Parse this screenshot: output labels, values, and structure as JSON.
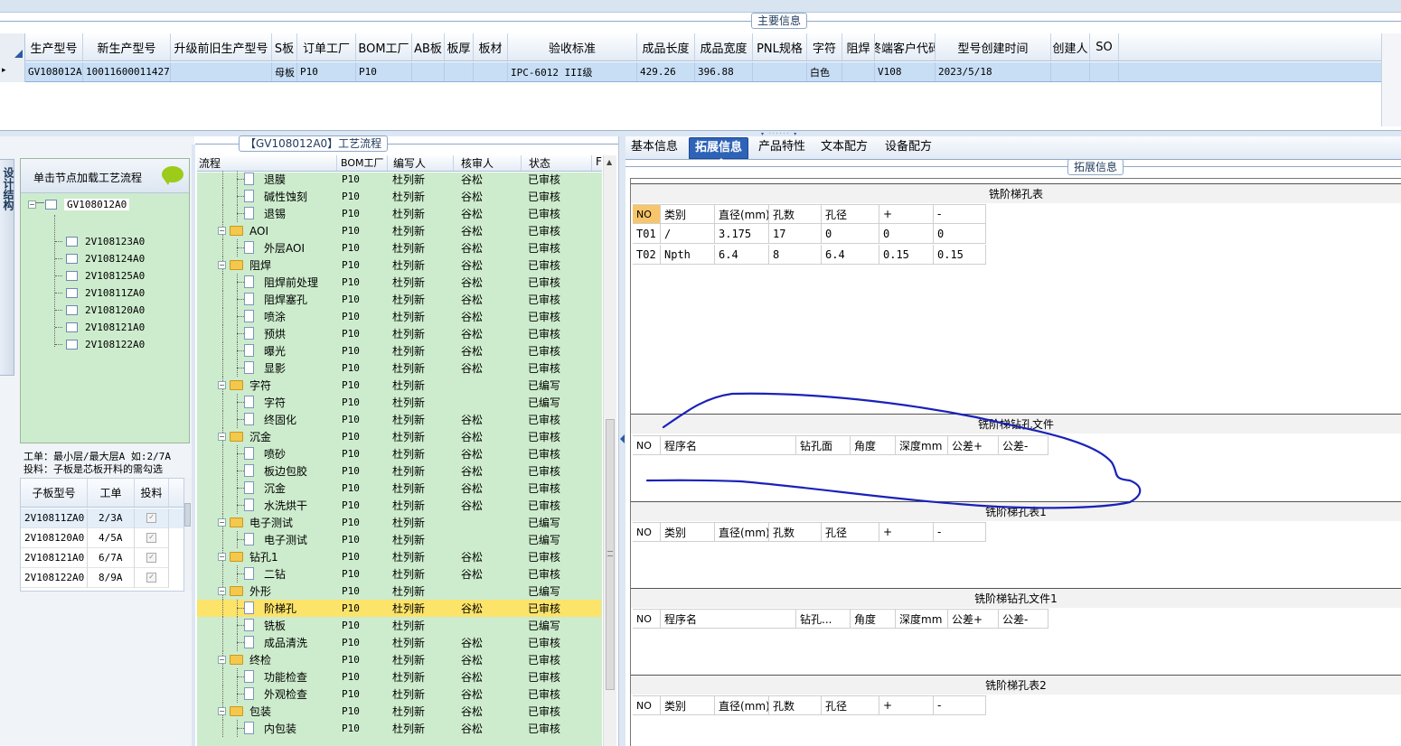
{
  "main_info": {
    "title": "主要信息",
    "columns": [
      "生产型号",
      "新生产型号",
      "升级前旧生产型号",
      "S板",
      "订单工厂",
      "BOM工厂",
      "AB板",
      "板厚",
      "板材",
      "验收标准",
      "成品长度",
      "成品宽度",
      "PNL规格",
      "字符",
      "阻焊",
      "终端客户代码",
      "型号创建时间",
      "创建人",
      "SO"
    ],
    "row": [
      "GV108012A0",
      "10011600011427",
      "",
      "母板",
      "P10",
      "P10",
      "",
      "",
      "",
      "IPC-6012 III级",
      "429.26",
      "396.88",
      "",
      "白色",
      "",
      "V108",
      "2023/5/18",
      "",
      ""
    ]
  },
  "left_panel": {
    "vertical_tab": "设计结构",
    "hint": "单击节点加载工艺流程",
    "tree_root": "GV108012A0",
    "tree_children": [
      "2V108123A0",
      "2V108124A0",
      "2V108125A0",
      "2V10811ZA0",
      "2V108120A0",
      "2V108121A0",
      "2V108122A0"
    ],
    "note_line1": "工单：最小层/最大层A 如:2/7A",
    "note_line2": "投料：子板是芯板开料的需勾选",
    "sub_headers": [
      "子板型号",
      "工单",
      "投料"
    ],
    "sub_rows": [
      {
        "model": "2V10811ZA0",
        "order": "2/3A"
      },
      {
        "model": "2V108120A0",
        "order": "4/5A"
      },
      {
        "model": "2V108121A0",
        "order": "6/7A"
      },
      {
        "model": "2V108122A0",
        "order": "8/9A"
      }
    ]
  },
  "process": {
    "title": "【GV108012A0】工艺流程",
    "headers": [
      "流程",
      "BOM工厂",
      "编写人",
      "核审人",
      "状态",
      "F"
    ],
    "rows": [
      {
        "name": "退膜",
        "type": "leaf",
        "bom": "P10",
        "writer": "杜列新",
        "reviewer": "谷松",
        "status": "已审核"
      },
      {
        "name": "碱性蚀刻",
        "type": "leaf",
        "bom": "P10",
        "writer": "杜列新",
        "reviewer": "谷松",
        "status": "已审核"
      },
      {
        "name": "退锡",
        "type": "leaf",
        "bom": "P10",
        "writer": "杜列新",
        "reviewer": "谷松",
        "status": "已审核"
      },
      {
        "name": "AOI",
        "type": "folder",
        "bom": "P10",
        "writer": "杜列新",
        "reviewer": "谷松",
        "status": "已审核"
      },
      {
        "name": "外层AOI",
        "type": "leaf",
        "bom": "P10",
        "writer": "杜列新",
        "reviewer": "谷松",
        "status": "已审核"
      },
      {
        "name": "阻焊",
        "type": "folder",
        "bom": "P10",
        "writer": "杜列新",
        "reviewer": "谷松",
        "status": "已审核"
      },
      {
        "name": "阻焊前处理",
        "type": "leaf",
        "bom": "P10",
        "writer": "杜列新",
        "reviewer": "谷松",
        "status": "已审核"
      },
      {
        "name": "阻焊塞孔",
        "type": "leaf",
        "bom": "P10",
        "writer": "杜列新",
        "reviewer": "谷松",
        "status": "已审核"
      },
      {
        "name": "喷涂",
        "type": "leaf",
        "bom": "P10",
        "writer": "杜列新",
        "reviewer": "谷松",
        "status": "已审核"
      },
      {
        "name": "预烘",
        "type": "leaf",
        "bom": "P10",
        "writer": "杜列新",
        "reviewer": "谷松",
        "status": "已审核"
      },
      {
        "name": "曝光",
        "type": "leaf",
        "bom": "P10",
        "writer": "杜列新",
        "reviewer": "谷松",
        "status": "已审核"
      },
      {
        "name": "显影",
        "type": "leaf",
        "bom": "P10",
        "writer": "杜列新",
        "reviewer": "谷松",
        "status": "已审核"
      },
      {
        "name": "字符",
        "type": "folder",
        "bom": "P10",
        "writer": "杜列新",
        "reviewer": "",
        "status": "已编写"
      },
      {
        "name": "字符",
        "type": "leaf",
        "bom": "P10",
        "writer": "杜列新",
        "reviewer": "",
        "status": "已编写"
      },
      {
        "name": "终固化",
        "type": "leaf",
        "bom": "P10",
        "writer": "杜列新",
        "reviewer": "谷松",
        "status": "已审核"
      },
      {
        "name": "沉金",
        "type": "folder",
        "bom": "P10",
        "writer": "杜列新",
        "reviewer": "谷松",
        "status": "已审核"
      },
      {
        "name": "喷砂",
        "type": "leaf",
        "bom": "P10",
        "writer": "杜列新",
        "reviewer": "谷松",
        "status": "已审核"
      },
      {
        "name": "板边包胶",
        "type": "leaf",
        "bom": "P10",
        "writer": "杜列新",
        "reviewer": "谷松",
        "status": "已审核"
      },
      {
        "name": "沉金",
        "type": "leaf",
        "bom": "P10",
        "writer": "杜列新",
        "reviewer": "谷松",
        "status": "已审核"
      },
      {
        "name": "水洗烘干",
        "type": "leaf",
        "bom": "P10",
        "writer": "杜列新",
        "reviewer": "谷松",
        "status": "已审核"
      },
      {
        "name": "电子测试",
        "type": "folder",
        "bom": "P10",
        "writer": "杜列新",
        "reviewer": "",
        "status": "已编写"
      },
      {
        "name": "电子测试",
        "type": "leaf",
        "bom": "P10",
        "writer": "杜列新",
        "reviewer": "",
        "status": "已编写"
      },
      {
        "name": "钻孔1",
        "type": "folder",
        "bom": "P10",
        "writer": "杜列新",
        "reviewer": "谷松",
        "status": "已审核"
      },
      {
        "name": "二钻",
        "type": "leaf",
        "bom": "P10",
        "writer": "杜列新",
        "reviewer": "谷松",
        "status": "已审核"
      },
      {
        "name": "外形",
        "type": "folder",
        "bom": "P10",
        "writer": "杜列新",
        "reviewer": "",
        "status": "已编写"
      },
      {
        "name": "阶梯孔",
        "type": "leaf",
        "bom": "P10",
        "writer": "杜列新",
        "reviewer": "谷松",
        "status": "已审核",
        "selected": true
      },
      {
        "name": "铣板",
        "type": "leaf",
        "bom": "P10",
        "writer": "杜列新",
        "reviewer": "",
        "status": "已编写"
      },
      {
        "name": "成品清洗",
        "type": "leaf",
        "bom": "P10",
        "writer": "杜列新",
        "reviewer": "谷松",
        "status": "已审核"
      },
      {
        "name": "终检",
        "type": "folder",
        "bom": "P10",
        "writer": "杜列新",
        "reviewer": "谷松",
        "status": "已审核"
      },
      {
        "name": "功能检查",
        "type": "leaf",
        "bom": "P10",
        "writer": "杜列新",
        "reviewer": "谷松",
        "status": "已审核"
      },
      {
        "name": "外观检查",
        "type": "leaf",
        "bom": "P10",
        "writer": "杜列新",
        "reviewer": "谷松",
        "status": "已审核"
      },
      {
        "name": "包装",
        "type": "folder",
        "bom": "P10",
        "writer": "杜列新",
        "reviewer": "谷松",
        "status": "已审核"
      },
      {
        "name": "内包装",
        "type": "leaf",
        "bom": "P10",
        "writer": "杜列新",
        "reviewer": "谷松",
        "status": "已审核"
      }
    ]
  },
  "right_panel": {
    "tabs": [
      "基本信息",
      "拓展信息",
      "产品特性",
      "文本配方",
      "设备配方"
    ],
    "active_tab": "拓展信息",
    "group_title": "拓展信息",
    "t1": {
      "title": "铣阶梯孔表",
      "headers": [
        "NO",
        "类别",
        "直径(mm)",
        "孔数",
        "孔径",
        "+",
        "-"
      ],
      "rows": [
        [
          "T01",
          "/",
          "3.175",
          "17",
          "0",
          "0",
          "0"
        ],
        [
          "T02",
          "Npth",
          "6.4",
          "8",
          "6.4",
          "0.15",
          "0.15"
        ]
      ]
    },
    "t2": {
      "title": "铣阶梯钻孔文件",
      "headers": [
        "NO",
        "程序名",
        "钻孔面",
        "角度",
        "深度mm",
        "公差+",
        "公差-"
      ]
    },
    "t3": {
      "title": "铣阶梯孔表1",
      "headers": [
        "NO",
        "类别",
        "直径(mm)",
        "孔数",
        "孔径",
        "+",
        "-"
      ]
    },
    "t4": {
      "title": "铣阶梯钻孔文件1",
      "headers": [
        "NO",
        "程序名",
        "钻孔...",
        "角度",
        "深度mm",
        "公差+",
        "公差-"
      ]
    },
    "t5": {
      "title": "铣阶梯孔表2",
      "headers": [
        "NO",
        "类别",
        "直径(mm)",
        "孔数",
        "孔径",
        "+",
        "-"
      ]
    }
  },
  "colors": {
    "accent": "#2e63b8",
    "tree_bg": "#cdeccd",
    "selected_row": "#fce36a",
    "annotation": "#1a22b8"
  }
}
